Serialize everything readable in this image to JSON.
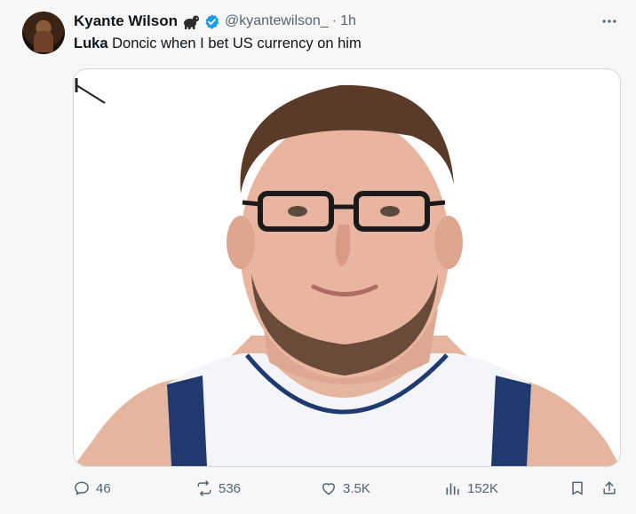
{
  "tweet": {
    "author_name": "Kyante Wilson",
    "author_emoji": "gorilla-emoji",
    "verified": "verified-badge-icon",
    "handle": "@kyantewilson_",
    "separator": "·",
    "time": "1h",
    "text_bold": "Luka",
    "text_rest": " Doncic when I bet US currency on him",
    "media_description_icon": "photo-media",
    "accent_color": "#1d9bf0"
  },
  "actions": {
    "replies": "46",
    "reposts": "536",
    "likes": "3.5K",
    "views": "152K"
  }
}
